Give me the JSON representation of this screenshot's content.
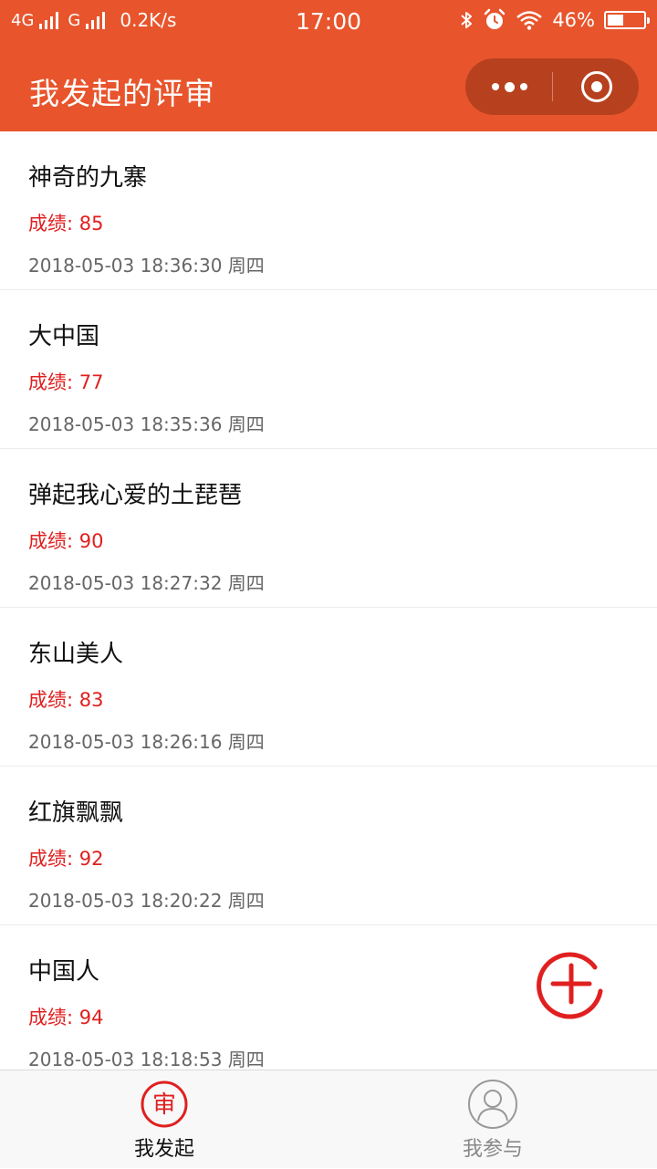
{
  "status_bar": {
    "network1": "4G",
    "network2": "G",
    "speed": "0.2K/s",
    "time": "17:00",
    "battery": "46%",
    "battery_level": 0.46
  },
  "header": {
    "title": "我发起的评审"
  },
  "reviews": [
    {
      "title": "神奇的九寨",
      "score": "成绩: 85",
      "time": "2018-05-03 18:36:30 周四"
    },
    {
      "title": "大中国",
      "score": "成绩: 77",
      "time": "2018-05-03 18:35:36 周四"
    },
    {
      "title": "弹起我心爱的土琵琶",
      "score": "成绩: 90",
      "time": "2018-05-03 18:27:32 周四"
    },
    {
      "title": "东山美人",
      "score": "成绩: 83",
      "time": "2018-05-03 18:26:16 周四"
    },
    {
      "title": "红旗飘飘",
      "score": "成绩: 92",
      "time": "2018-05-03 18:20:22 周四"
    },
    {
      "title": "中国人",
      "score": "成绩: 94",
      "time": "2018-05-03 18:18:53 周四"
    }
  ],
  "tabbar": {
    "tabs": [
      {
        "label": "我发起",
        "icon_glyph": "审",
        "icon": "review-stamp-icon",
        "active": true
      },
      {
        "label": "我参与",
        "icon": "user-icon",
        "active": false
      }
    ]
  },
  "colors": {
    "brand": "#E8542C",
    "score": "#E02020",
    "active_icon": "#E02020",
    "inactive": "#999999"
  }
}
